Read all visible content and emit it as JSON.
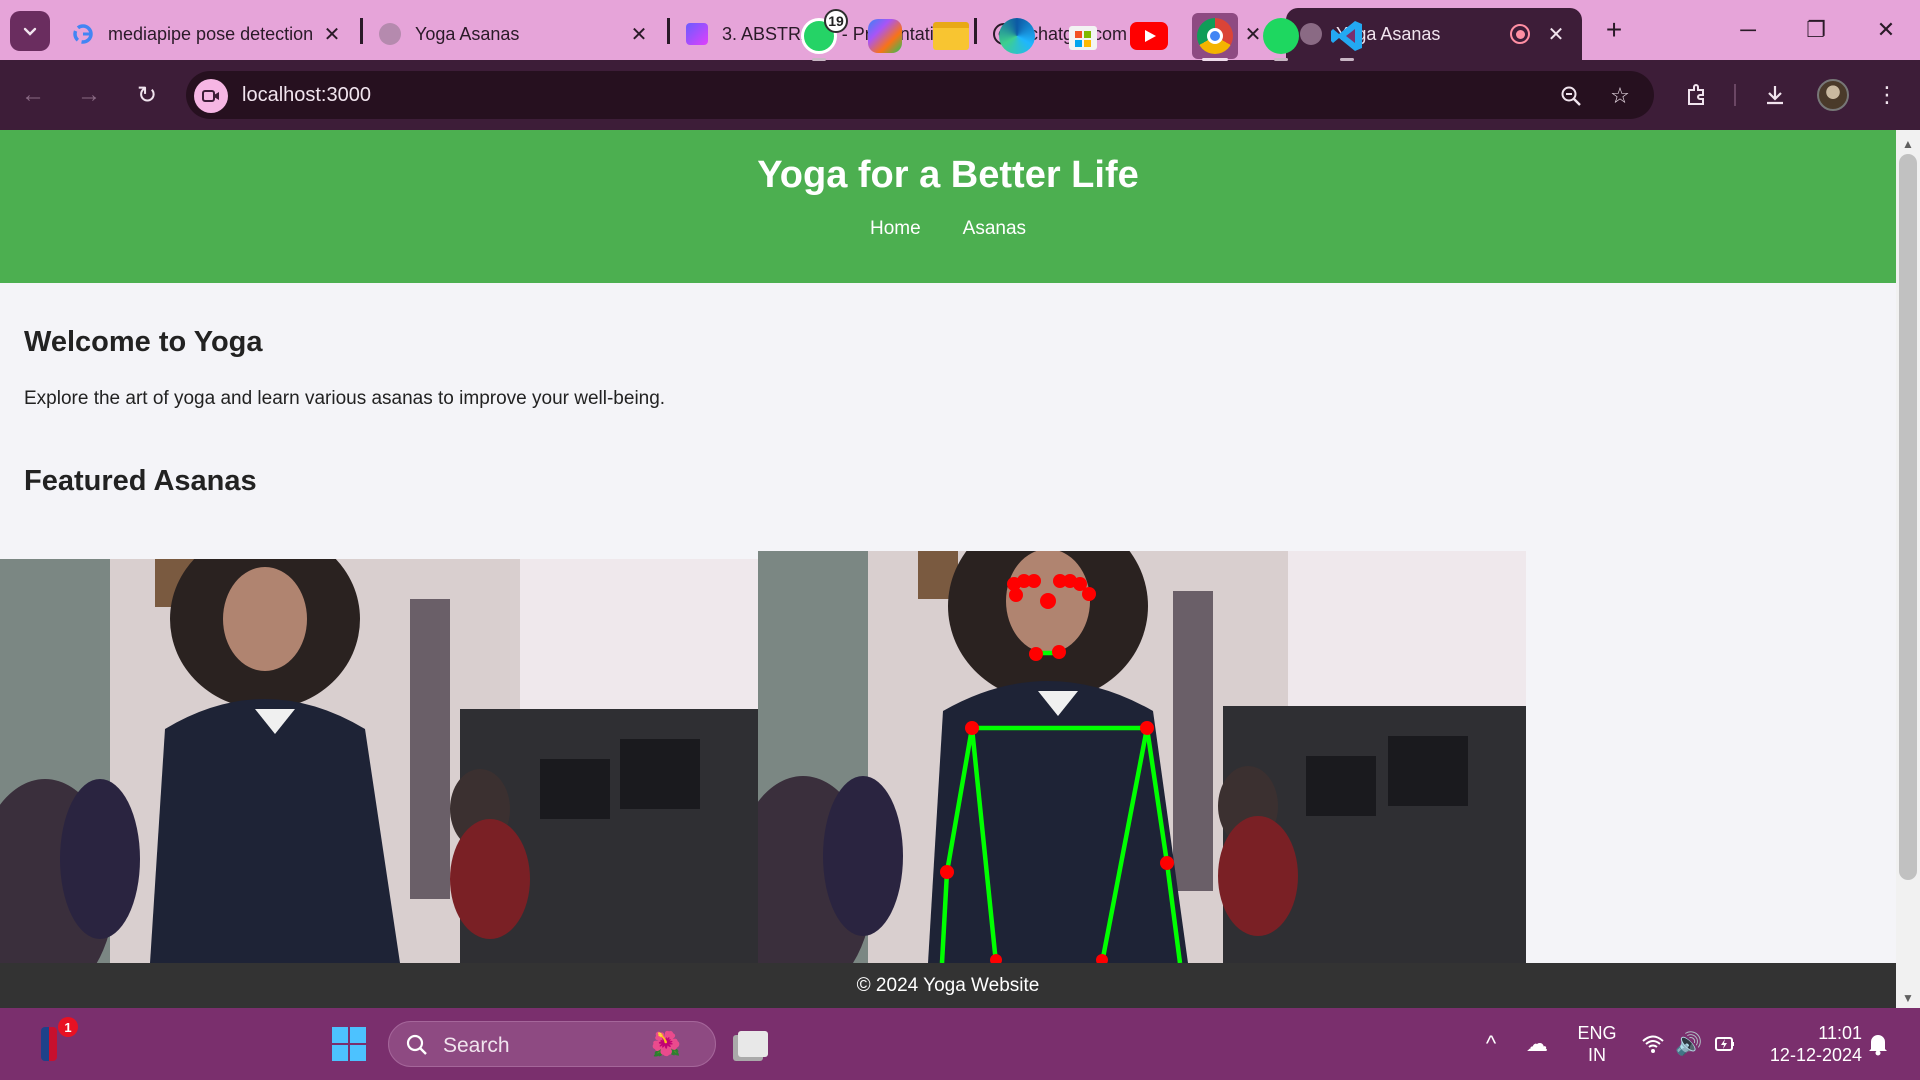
{
  "browser": {
    "tabs": [
      {
        "title": "mediapipe pose detection",
        "favicon": "google-g-icon",
        "active": false
      },
      {
        "title": "Yoga Asanas",
        "favicon": "globe-icon",
        "active": false
      },
      {
        "title": "3. ABSTRACT - Presentation",
        "favicon": "presentation-icon",
        "active": false
      },
      {
        "title": "chatgpt.com",
        "favicon": "chatgpt-icon",
        "active": false
      },
      {
        "title": "Yoga Asanas",
        "favicon": "globe-icon",
        "active": true,
        "recording": true
      }
    ],
    "url": "localhost:3000"
  },
  "site": {
    "title": "Yoga for a Better Life",
    "nav": [
      "Home",
      "Asanas"
    ],
    "welcome_heading": "Welcome to Yoga",
    "welcome_text": "Explore the art of yoga and learn various asanas to improve your well-being.",
    "featured_heading": "Featured Asanas",
    "footer": "© 2024 Yoga Website",
    "colors": {
      "header": "#4caf50",
      "footer": "#333333",
      "skeleton_line": "#00ff00",
      "skeleton_point": "#ff0000"
    }
  },
  "taskbar": {
    "search_label": "Search",
    "notification_count": "1",
    "whatsapp_badge": "19",
    "language": {
      "line1": "ENG",
      "line2": "IN"
    },
    "clock": {
      "time": "11:01",
      "date": "12-12-2024"
    },
    "apps": [
      "nba-icon",
      "windows-start-icon",
      "task-view-icon",
      "whatsapp-icon",
      "copilot-icon",
      "file-explorer-icon",
      "edge-icon",
      "store-icon",
      "youtube-icon",
      "chrome-icon",
      "spotify-icon",
      "vscode-icon"
    ]
  }
}
